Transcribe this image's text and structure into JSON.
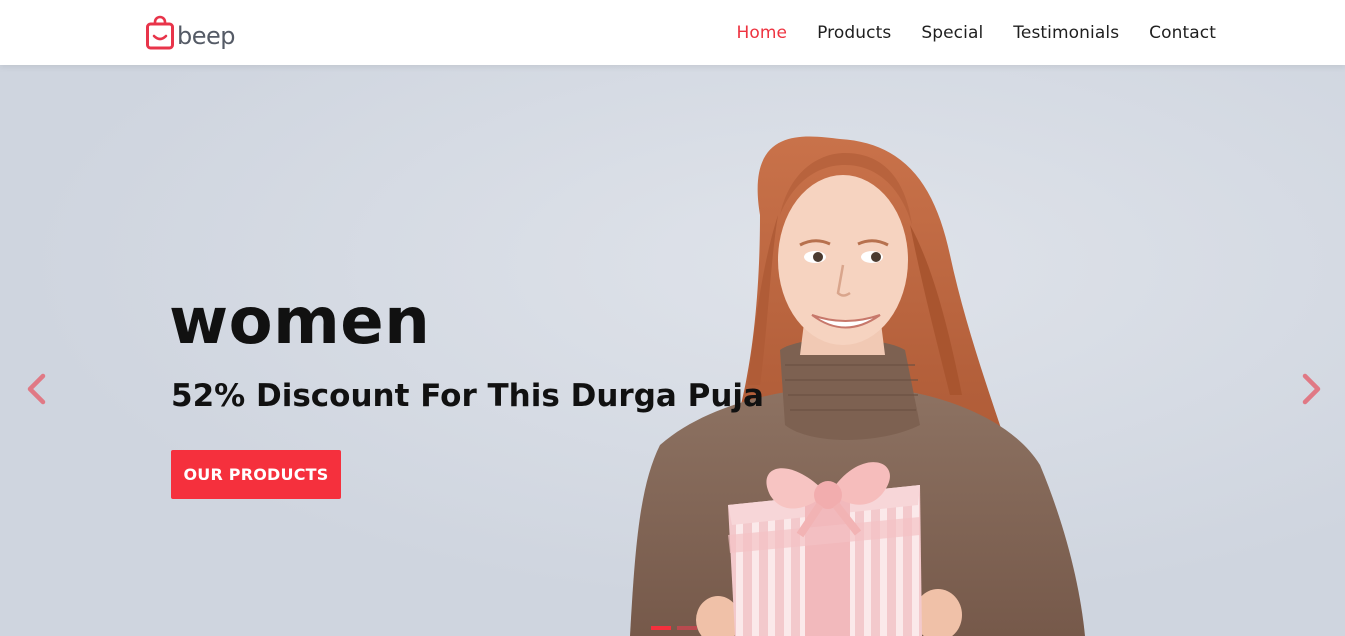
{
  "brand": {
    "name": "beep",
    "accent_color": "#ee3340",
    "logo_icon": "shopping-bag-icon"
  },
  "nav": {
    "items": [
      {
        "label": "Home",
        "active": true
      },
      {
        "label": "Products",
        "active": false
      },
      {
        "label": "Special",
        "active": false
      },
      {
        "label": "Testimonials",
        "active": false
      },
      {
        "label": "Contact",
        "active": false
      }
    ]
  },
  "hero": {
    "title": "women",
    "subtitle": "52% Discount For This Durga Puja",
    "cta_label": "OUR PRODUCTS",
    "prev_icon": "chevron-left-icon",
    "next_icon": "chevron-right-icon",
    "slides_count": 2,
    "active_slide": 1,
    "button_color": "#f5303d"
  }
}
